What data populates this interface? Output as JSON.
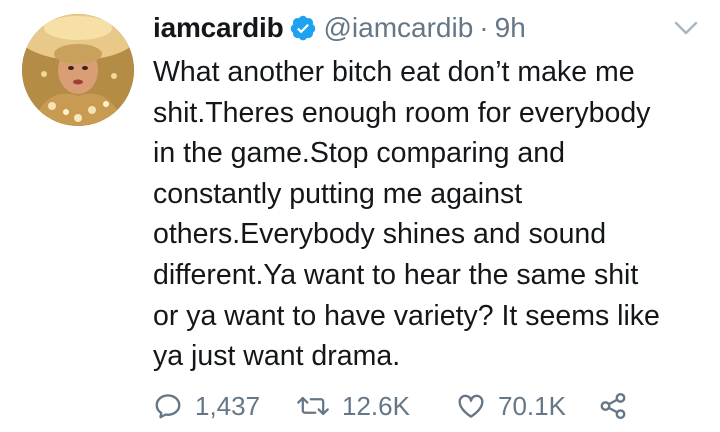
{
  "tweet": {
    "display_name": "iamcardib",
    "verified": true,
    "handle": "@iamcardib",
    "separator": "·",
    "time": "9h",
    "text_lines": [
      "What another bitch eat don’t make me",
      "shit.Theres enough room for everybody",
      "in the game.Stop comparing and",
      "constantly putting me against",
      "others.Everybody shines and sound",
      "different.Ya want to hear the same shit",
      "or ya want to have variety? It seems like",
      "ya just want drama."
    ],
    "actions": {
      "reply_count": "1,437",
      "retweet_count": "12.6K",
      "like_count": "70.1K"
    },
    "icons": {
      "verified": "verified-badge-icon",
      "caret": "chevron-down-icon",
      "reply": "reply-icon",
      "retweet": "retweet-icon",
      "like": "heart-icon",
      "share": "share-icon"
    }
  },
  "colors": {
    "text": "#14171a",
    "secondary": "#657786",
    "verified": "#1da1f2",
    "background": "#ffffff"
  }
}
